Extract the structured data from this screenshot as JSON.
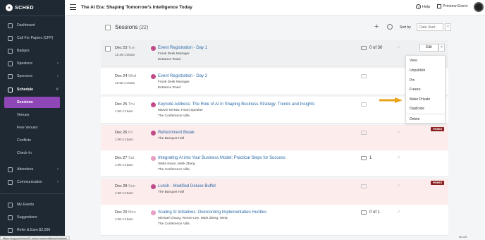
{
  "app": {
    "logo_mark": "✶",
    "logo_text": "SCHED",
    "title": "The AI Era: Shaping Tomorrow's Intelligence Today",
    "help": "Help",
    "preview": "Preview Event"
  },
  "sidebar": {
    "items": [
      {
        "label": "Dashboard"
      },
      {
        "label": "Call For Papers (CFP)"
      },
      {
        "label": "Badges"
      },
      {
        "label": "Speakers"
      },
      {
        "label": "Sponsors"
      },
      {
        "label": "Schedule"
      },
      {
        "label": "Sessions"
      },
      {
        "label": "Venues"
      },
      {
        "label": "Free Venues"
      },
      {
        "label": "Conflicts"
      },
      {
        "label": "Check-In"
      },
      {
        "label": "Attendees"
      },
      {
        "label": "Communication"
      },
      {
        "label": "My Events"
      },
      {
        "label": "Suggestions"
      },
      {
        "label": "Refer & Earn $2,000"
      }
    ],
    "url_tooltip": "https://supportdemo21.sched.com/editor/schedule#"
  },
  "sessions": {
    "title": "Sessions",
    "count": "(22)",
    "sort_label": "Sort by",
    "sort_value": "Date Start"
  },
  "rows": [
    {
      "date": "Dec 23",
      "day": "Tue",
      "time": "12:45-1:00am",
      "title": "Event Registration - Day 1",
      "sub1": "Fronk Desk Manager",
      "sub2": "Entrance Road",
      "seats": "0 of 30"
    },
    {
      "date": "Dec 24",
      "day": "Wed",
      "time": "12:55-1:10am",
      "title": "Event Registration - Day 2",
      "sub1": "Fronk Desk Manager",
      "sub2": "Entrance Road",
      "seats": ""
    },
    {
      "date": "Dec 25",
      "day": "Thu",
      "time": "1:00-1:15am",
      "title": "Keynote Address: The Role of AI in Shaping Business Strategy: Trends and Insights",
      "sub1": "Marvin McTaw, Heart Speaker",
      "sub2": "The Conference Villa",
      "seats": ""
    },
    {
      "date": "Dec 26",
      "day": "Fri",
      "time": "1:00-1:15am",
      "title": "Refreshment Break",
      "sub1": "The Banquet Hall",
      "sub2": "",
      "seats": "",
      "badge": "PINNED"
    },
    {
      "date": "Dec 27",
      "day": "Sat",
      "time": "1:00-1:15am",
      "title": "Integrating AI into Your Business Model: Practical Steps for Success",
      "sub1": "Stella Kwan, Mark Zberg",
      "sub2": "The Conference Villa",
      "seats": "1"
    },
    {
      "date": "Dec 28",
      "day": "Sun",
      "time": "1:00-1:15am",
      "title": "Lunch - Modified Deluxe Buffet",
      "sub1": "The Banquet Hall",
      "sub2": "",
      "seats": "",
      "badge": "PINNED"
    },
    {
      "date": "Dec 29",
      "day": "Mon",
      "time": "1:00-1:15am",
      "title": "Scaling AI Initiatives: Overcoming Implementation Hurdles",
      "sub1": "Michael Chang, Renee Lee, Mark Zberg, Meta",
      "sub2": "The Conference Villa",
      "seats": "0 of 1"
    }
  ],
  "edit": {
    "label": "Edit",
    "caret": "˄"
  },
  "menu": [
    "View",
    "Unpublish",
    "Pin",
    "Freeze",
    "Make Private",
    "Duplicate",
    "Delete"
  ],
  "boost": "Boost",
  "colors": {
    "sidebar": "#1f2933",
    "active": "#8f47b8",
    "dot": "#c14b8a",
    "dot_light": "#e89dc4",
    "link": "#2b6aa8",
    "pinned_row": "#fcecec",
    "pinned_badge": "#8a1f1f",
    "arrow": "#e8a317"
  }
}
